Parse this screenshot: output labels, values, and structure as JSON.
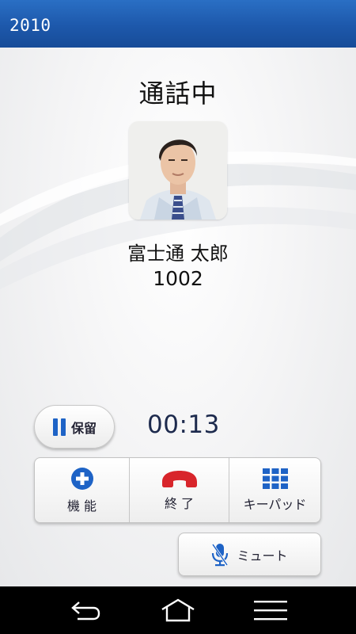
{
  "status_bar": {
    "label": "2010"
  },
  "call": {
    "state": "通話中",
    "contact_name": "富士通 太郎",
    "contact_number": "1002",
    "duration": "00:13"
  },
  "controls": {
    "hold_label": "保留",
    "functions_label": "機 能",
    "end_label": "終 了",
    "keypad_label": "キーパッド",
    "mute_label": "ミュート"
  },
  "icons": {
    "hold": "pause-icon",
    "functions": "plus-circle-icon",
    "end": "hang-up-icon",
    "keypad": "keypad-grid-icon",
    "mute": "microphone-off-icon",
    "nav_back": "back-arrow-icon",
    "nav_home": "home-icon",
    "nav_menu": "menu-icon"
  },
  "colors": {
    "status_bar": "#1d58ab",
    "accent_blue": "#1e63c6",
    "end_call_red": "#d8252b",
    "timer_text": "#1d2a4d"
  }
}
